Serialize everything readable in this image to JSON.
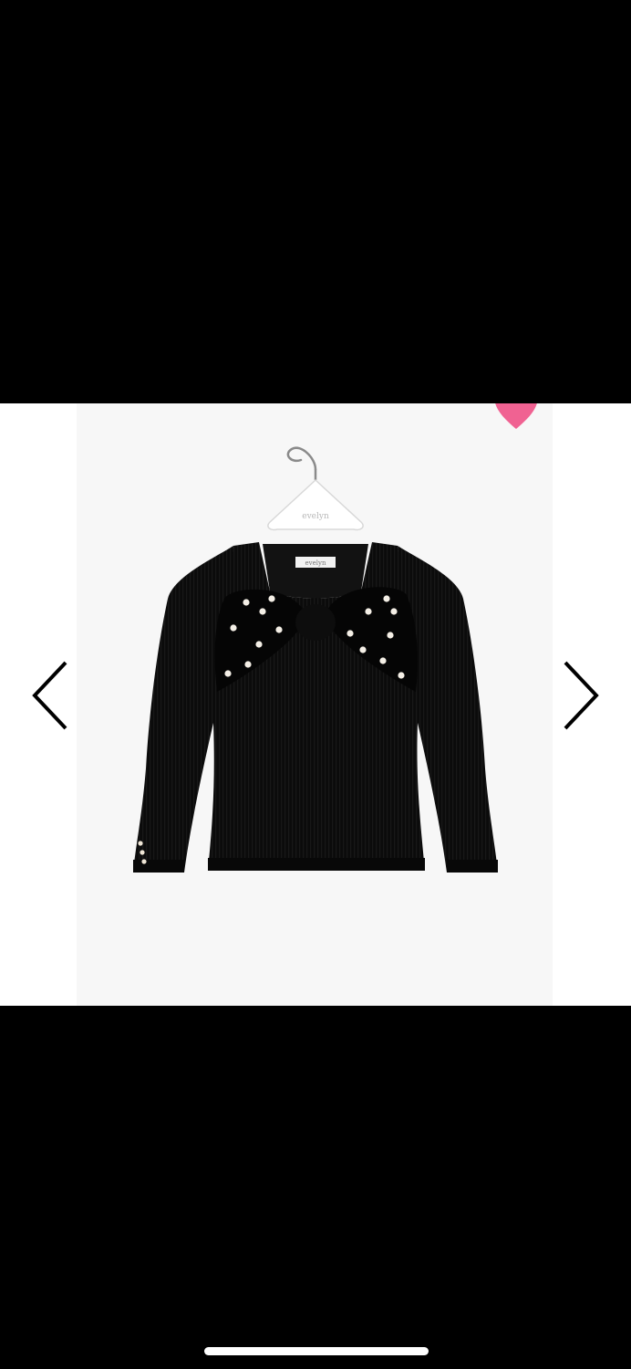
{
  "viewer": {
    "heart_icon": "heart-icon",
    "prev_icon": "chevron-left-icon",
    "next_icon": "chevron-right-icon",
    "hanger_brand": "evelyn",
    "label_text": "evelyn"
  },
  "colors": {
    "background": "#000000",
    "viewer_bg": "#ffffff",
    "photo_bg": "#f7f7f7",
    "garment": "#0a0a0a",
    "heart": "#f06292",
    "arrow": "#000000",
    "home_indicator": "#ffffff"
  }
}
